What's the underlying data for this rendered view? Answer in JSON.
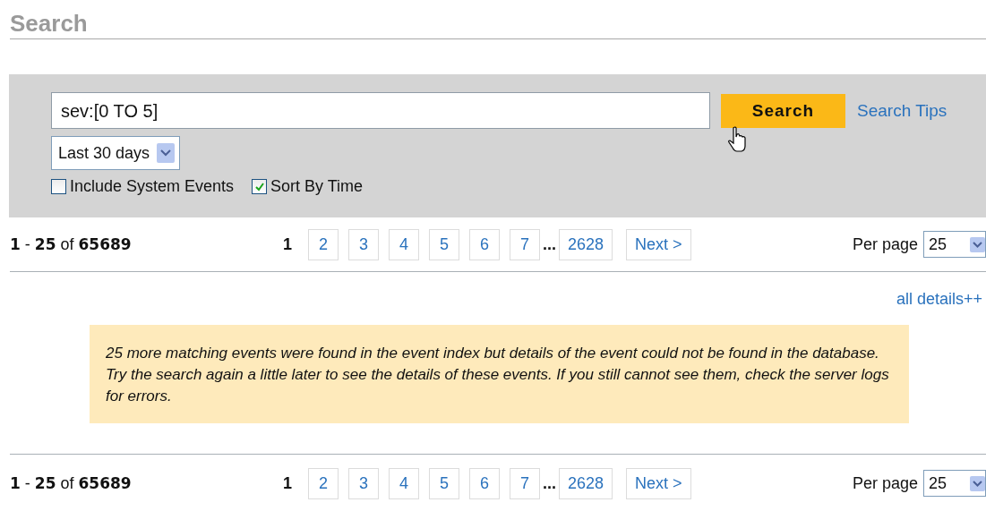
{
  "page": {
    "title": "Search"
  },
  "search": {
    "value": "sev:[0 TO 5]",
    "button": "Search",
    "tips_link": "Search Tips",
    "range": "Last 30 days",
    "options": [
      {
        "label": "Include System Events",
        "checked": false
      },
      {
        "label": "Sort By Time",
        "checked": true
      }
    ]
  },
  "pagination": [
    {
      "range": "**1** - **25** of **65689**",
      "pages": [
        {
          "label": "1",
          "selected": true
        },
        {
          "label": "2",
          "selected": false
        },
        {
          "label": "3",
          "selected": false
        },
        {
          "label": "4",
          "selected": false
        },
        {
          "label": "5",
          "selected": false
        },
        {
          "label": "6",
          "selected": false
        },
        {
          "label": "7",
          "selected": false
        }
      ],
      "ellipsis": "...",
      "last_page": "2628",
      "next": "Next >",
      "per_page_label": "Per page",
      "per_page": "25"
    },
    {
      "range": "**1** - **25** of **65689**",
      "pages": [
        {
          "label": "1",
          "selected": true
        },
        {
          "label": "2",
          "selected": false
        },
        {
          "label": "3",
          "selected": false
        },
        {
          "label": "4",
          "selected": false
        },
        {
          "label": "5",
          "selected": false
        },
        {
          "label": "6",
          "selected": false
        },
        {
          "label": "7",
          "selected": false
        }
      ],
      "ellipsis": "...",
      "last_page": "2628",
      "next": "Next >",
      "per_page_label": "Per page",
      "per_page": "25"
    }
  ],
  "details_link": "all details++",
  "notice": "25 more matching events were found in the event index but details of the event could not be found in the database. Try the search again a little later to see the details of these events. If you still cannot see them, check the server logs for errors."
}
